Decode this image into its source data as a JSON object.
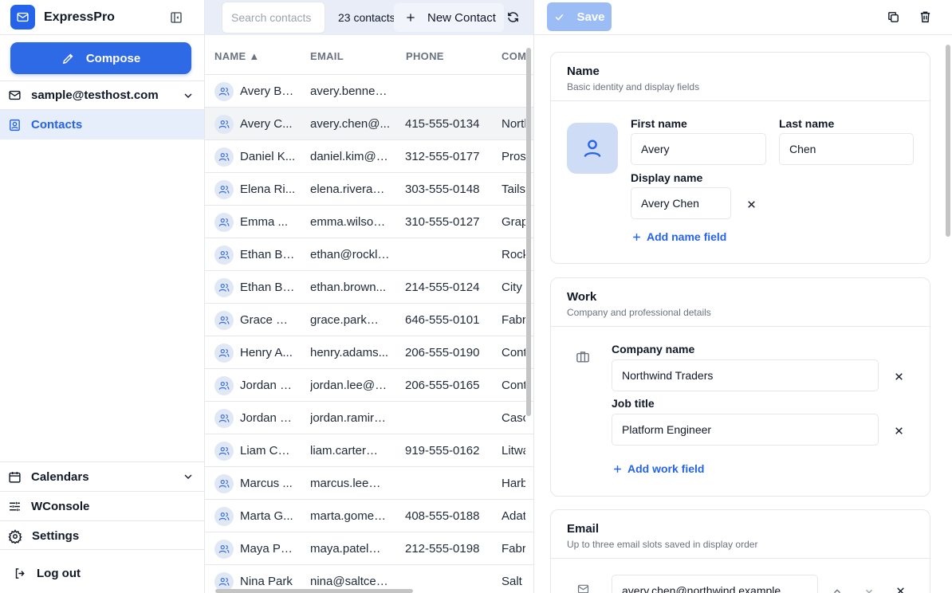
{
  "app": {
    "name": "ExpressPro"
  },
  "sidebar": {
    "compose_label": "Compose",
    "account": "sample@testhost.com",
    "contacts_label": "Contacts",
    "calendars_label": "Calendars",
    "wconsole_label": "WConsole",
    "settings_label": "Settings",
    "logout_label": "Log out"
  },
  "list": {
    "search_placeholder": "Search contacts",
    "count": "23 contacts",
    "new_contact_label": "New Contact",
    "columns": {
      "name": "NAME ▲",
      "email": "EMAIL",
      "phone": "PHONE",
      "company": "COM"
    },
    "rows": [
      {
        "name": "Avery Be...",
        "email": "avery.bennett...",
        "phone": "",
        "company": ""
      },
      {
        "name": "Avery C...",
        "email": "avery.chen@...",
        "phone": "415-555-0134",
        "company": "Northwind"
      },
      {
        "name": "Daniel K...",
        "email": "daniel.kim@p...",
        "phone": "312-555-0177",
        "company": "Prose"
      },
      {
        "name": "Elena Ri...",
        "email": "elena.rivera@...",
        "phone": "303-555-0148",
        "company": "Tailspin"
      },
      {
        "name": "Emma ...",
        "email": "emma.wilson...",
        "phone": "310-555-0127",
        "company": "Graphic"
      },
      {
        "name": "Ethan Br...",
        "email": "ethan@rockli...",
        "phone": "",
        "company": "Rockli"
      },
      {
        "name": "Ethan Br...",
        "email": "ethan.brown...",
        "phone": "214-555-0124",
        "company": "City Power"
      },
      {
        "name": "Grace Pa...",
        "email": "grace.park@f...",
        "phone": "646-555-0101",
        "company": "Fabrikam"
      },
      {
        "name": "Henry A...",
        "email": "henry.adams...",
        "phone": "206-555-0190",
        "company": "Contoso"
      },
      {
        "name": "Jordan L...",
        "email": "jordan.lee@c...",
        "phone": "206-555-0165",
        "company": "Contoso"
      },
      {
        "name": "Jordan R...",
        "email": "jordan.ramire...",
        "phone": "",
        "company": "Cascade"
      },
      {
        "name": "Liam Car...",
        "email": "liam.carter@li...",
        "phone": "919-555-0162",
        "company": "Litware"
      },
      {
        "name": "Marcus ...",
        "email": "marcus.lee@...",
        "phone": "",
        "company": "Harbor"
      },
      {
        "name": "Marta G...",
        "email": "marta.gomez...",
        "phone": "408-555-0188",
        "company": "Adatum"
      },
      {
        "name": "Maya Pa...",
        "email": "maya.patel@f...",
        "phone": "212-555-0198",
        "company": "Fabrikam"
      },
      {
        "name": "Nina Park",
        "email": "nina@saltced...",
        "phone": "",
        "company": "Salt & Cedar"
      }
    ]
  },
  "detail": {
    "save_label": "Save",
    "name_card": {
      "title": "Name",
      "subtitle": "Basic identity and display fields",
      "first_label": "First name",
      "first_value": "Avery",
      "last_label": "Last name",
      "last_value": "Chen",
      "display_label": "Display name",
      "display_value": "Avery Chen",
      "add_label": "Add name field"
    },
    "work_card": {
      "title": "Work",
      "subtitle": "Company and professional details",
      "company_label": "Company name",
      "company_value": "Northwind Traders",
      "job_label": "Job title",
      "job_value": "Platform Engineer",
      "add_label": "Add work field"
    },
    "email_card": {
      "title": "Email",
      "subtitle": "Up to three email slots saved in display order",
      "email_value": "avery.chen@northwind.example"
    }
  }
}
